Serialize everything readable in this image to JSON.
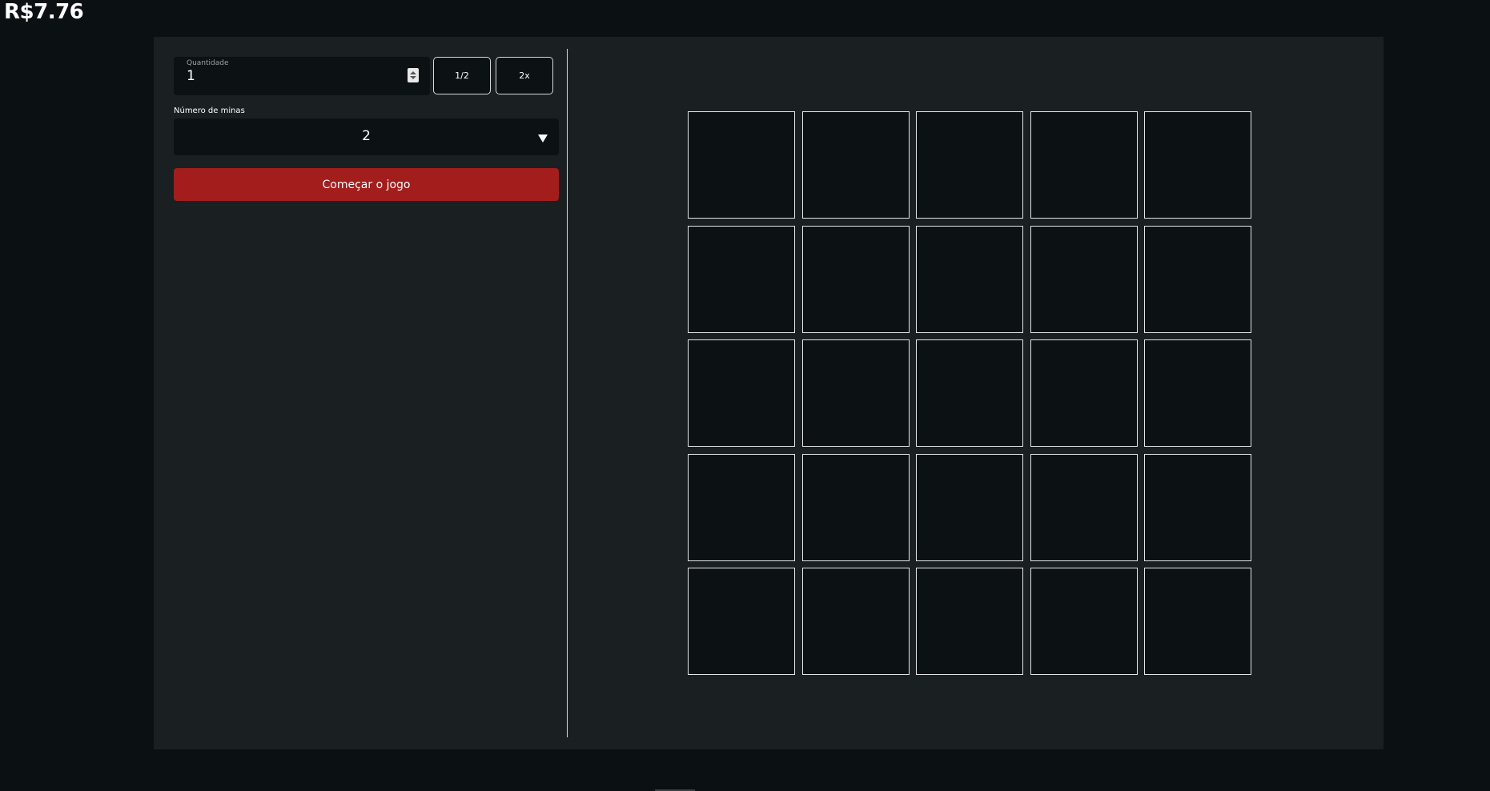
{
  "balance": "R$7.76",
  "bet": {
    "amount_label": "Quantidade",
    "amount_value": "1",
    "half_label": "1/2",
    "double_label": "2x"
  },
  "mines": {
    "label": "Número de minas",
    "selected": "2"
  },
  "start_button_label": "Começar o jogo",
  "board": {
    "rows": 5,
    "columns": 5
  },
  "colors": {
    "background": "#0b1013",
    "panel": "#1a1f22",
    "accent": "#a31d1d",
    "tile": "#0c1114"
  }
}
